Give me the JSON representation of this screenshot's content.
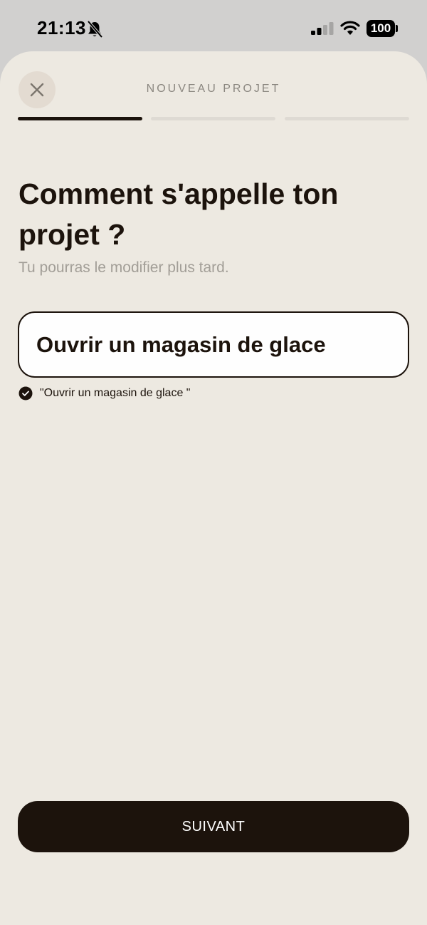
{
  "status_bar": {
    "time": "21:13",
    "battery": "100",
    "icons": [
      "bell-off-icon",
      "signal-icon",
      "wifi-icon",
      "battery-icon"
    ]
  },
  "header": {
    "title": "NOUVEAU PROJET",
    "close_icon": "close-icon",
    "steps_total": 3,
    "current_step": 1
  },
  "main": {
    "headline": "Comment s'appelle ton projet ?",
    "subtitle": "Tu pourras le modifier plus tard.",
    "project_name_value": "Ouvrir un magasin de glace",
    "suggestion": "\"Ouvrir un magasin de glace \""
  },
  "footer": {
    "next_label": "SUIVANT"
  },
  "colors": {
    "background": "#ede9e1",
    "accent": "#1c130c",
    "muted_text": "#a29e97",
    "inactive_progress": "#dedad3"
  }
}
